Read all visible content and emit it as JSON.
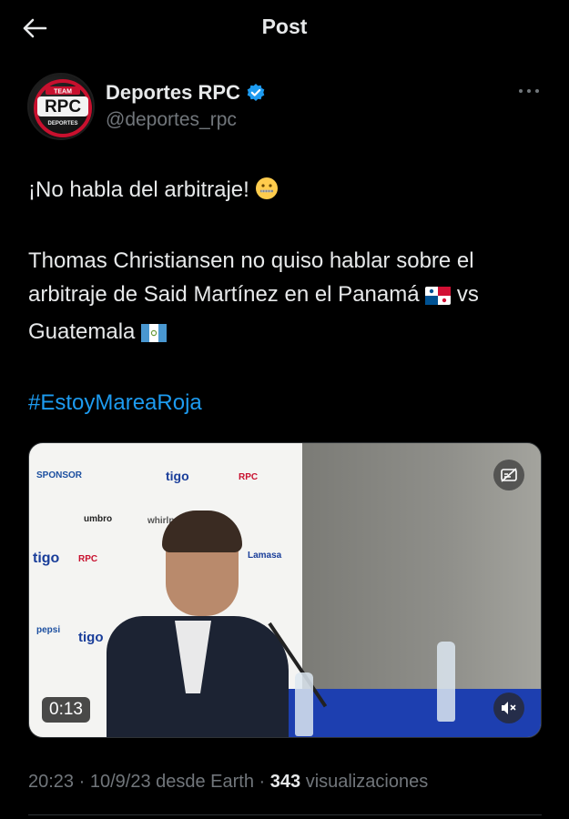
{
  "header": {
    "title": "Post"
  },
  "author": {
    "name": "Deportes RPC",
    "handle": "@deportes_rpc",
    "avatar_text": {
      "team": "TEAM",
      "brand": "RPC",
      "sub": "DEPORTES"
    }
  },
  "tweet": {
    "line1": "¡No habla del arbitraje!",
    "line2a": "Thomas Christiansen no quiso hablar sobre el arbitraje de Said Martínez en el Panamá",
    "line2b": "vs",
    "line2c": "Guatemala",
    "hashtag": "#EstoyMareaRoja",
    "emojis": [
      "zipper-mouth-face",
      "flag-panama",
      "flag-guatemala"
    ]
  },
  "media": {
    "duration": "0:13"
  },
  "meta": {
    "time": "20:23",
    "sep1": " · ",
    "date": "10/9/23",
    "source": " desde Earth",
    "sep2": " · ",
    "views_count": "343",
    "views_label": " visualizaciones"
  },
  "colors": {
    "background": "#000000",
    "text": "#e7e9ea",
    "secondary": "#71767b",
    "link": "#1d9bf0",
    "verified": "#1d9bf0"
  }
}
